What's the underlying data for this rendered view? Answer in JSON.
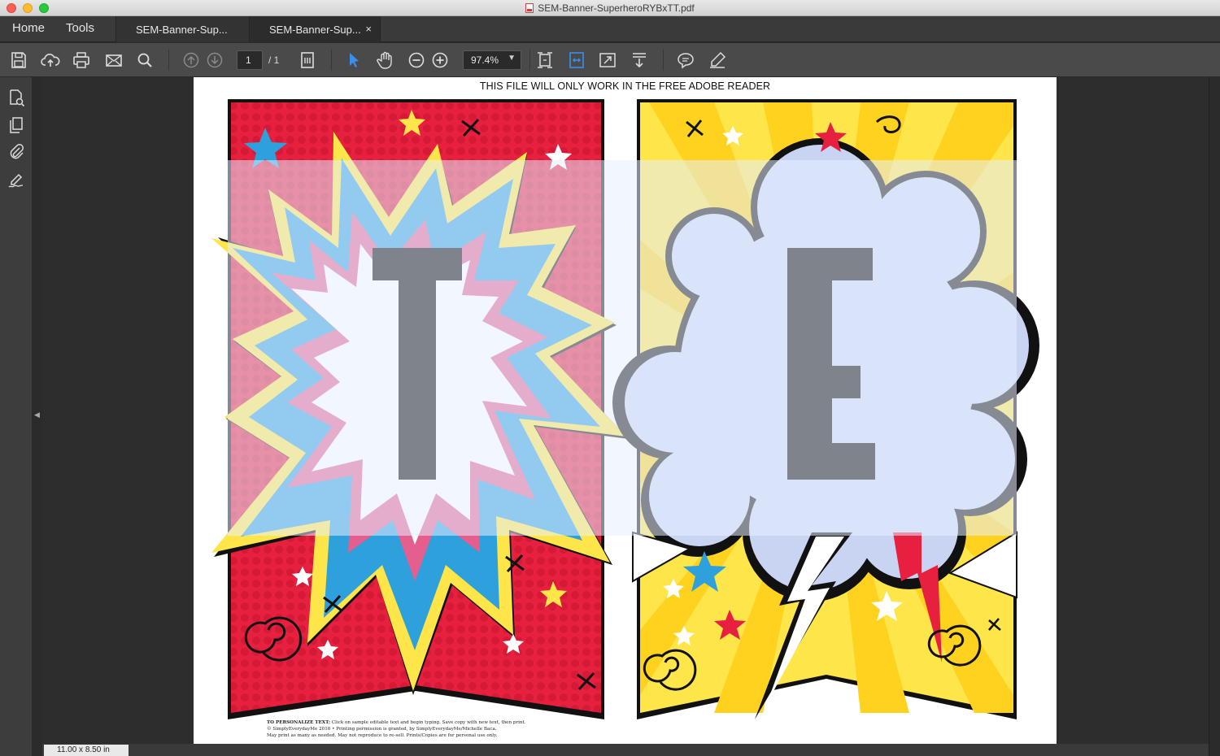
{
  "window": {
    "title": "SEM-Banner-SuperheroRYBxTT.pdf"
  },
  "nav": {
    "home": "Home",
    "tools": "Tools"
  },
  "tabs": [
    {
      "label": "SEM-Banner-Sup..."
    },
    {
      "label": "SEM-Banner-Sup...",
      "close": "×"
    }
  ],
  "toolbar": {
    "page_current": "1",
    "page_total": "/ 1",
    "zoom": "97.4%"
  },
  "document": {
    "header": "THIS FILE WILL ONLY WORK IN THE FREE ADOBE READER",
    "letters": [
      "T",
      "E"
    ],
    "footer_title": "TO PERSONALIZE TEXT:",
    "footer_line1": "Click on sample editable text and begin typing. Save copy with new text, then print.",
    "footer_line2": "© SimplyEverydayMe 2016 • Printing permission is granted, by SimplyEverydayMe/Michelle Baca.",
    "footer_line3": "May print as many as needed. May not reproduce to re-sell. Prints/Copies are for personal use only."
  },
  "status": {
    "page_size": "11.00 x 8.50 in"
  },
  "colors": {
    "accent_blue": "#3b8eea",
    "red": "#e8203f",
    "yellow": "#fde54a",
    "sky_blue": "#2ea0dc"
  }
}
